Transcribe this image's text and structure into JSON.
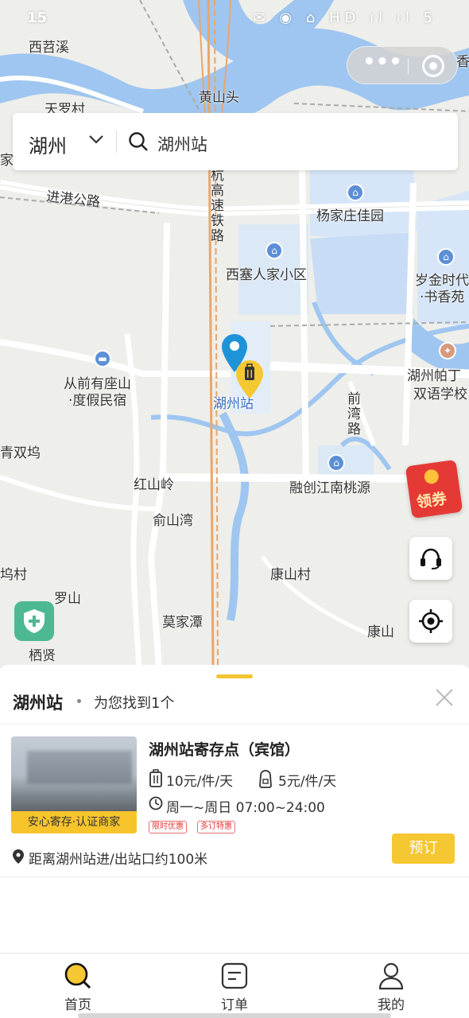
{
  "status_bar": {
    "time": "15",
    "icons": "✉ ◉ ⌂ HD ıl ıl 5"
  },
  "capsule": {
    "more_icon": "more-dots-icon",
    "close_icon": "target-circle-icon"
  },
  "search": {
    "city": "湖州",
    "query": "湖州站"
  },
  "map": {
    "labels": {
      "xitiaoxi": "西苕溪",
      "huangshantou": "黄山头",
      "tianluocun": "天罗村",
      "jiagang": "家圩",
      "jingang_road": "进港公路",
      "railway": "杭高速铁路",
      "yangjiazhuang": "杨家庄佳园",
      "xisai": "西塞人家小区",
      "suijin": "岁金时代",
      "shuxiang": "·书香苑",
      "congqian": "从前有座山",
      "dujia": "·度假民宿",
      "huzhou_station": "湖州站",
      "huzhou_pading": "湖州帕丁",
      "shuangyu": "双语学校",
      "qianwan_road": "前湾路",
      "qingshuangwu": "青双坞",
      "hongshanling": "红山岭",
      "rongchuang": "融创江南桃源",
      "yushanwan": "俞山湾",
      "kangshancun": "康山村",
      "wucun": "坞村",
      "luoshan": "罗山",
      "mojiatan": "莫家潭",
      "kangshan": "康山",
      "qixian": "栖贤",
      "xiang": "香"
    },
    "coupon_label": "领券",
    "fab_icons": [
      "headset-icon",
      "locate-icon",
      "shield-plus-icon"
    ]
  },
  "panel": {
    "title": "湖州站",
    "found_text": "为您找到1个",
    "store": {
      "name": "湖州站寄存点（宾馆）",
      "thumb_tag": "安心寄存·认证商家",
      "price_large": "10元/件/天",
      "price_small": "5元/件/天",
      "hours": "周一~周日 07:00~24:00",
      "promos": [
        "限时优惠",
        "多订特惠"
      ],
      "distance": "距离湖州站进/出站口约100米",
      "book_label": "预订"
    }
  },
  "tabbar": {
    "tabs": [
      {
        "label": "首页",
        "icon": "home-search-icon"
      },
      {
        "label": "订单",
        "icon": "order-icon"
      },
      {
        "label": "我的",
        "icon": "profile-icon"
      }
    ]
  },
  "colors": {
    "accent": "#f5c732",
    "water": "#9ec6f0",
    "coupon": "#e53935",
    "shield": "#4cb993"
  }
}
